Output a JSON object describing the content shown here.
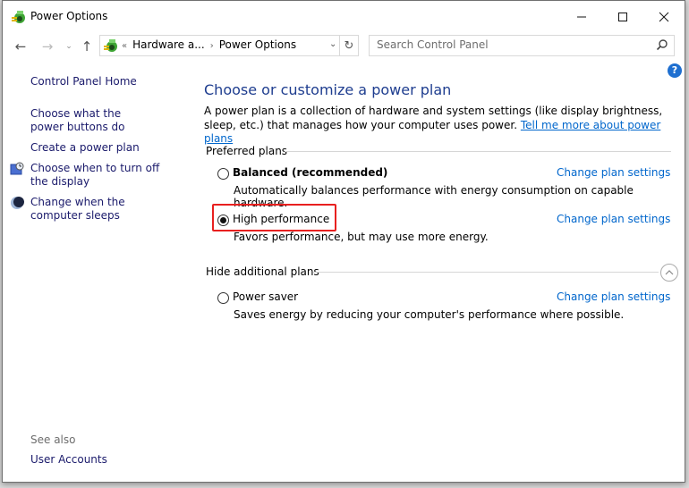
{
  "window": {
    "title": "Power Options",
    "controls": {
      "minimize": "minimize",
      "maximize": "maximize",
      "close": "close"
    }
  },
  "nav": {
    "back_icon": "arrow-left-icon",
    "forward_icon": "arrow-right-icon",
    "recent_icon": "chevron-down-icon",
    "up_icon": "arrow-up-icon",
    "breadcrumb_overflow": "«",
    "breadcrumb": [
      "Hardware a...",
      "Power Options"
    ],
    "breadcrumb_separator": "›",
    "refresh_icon": "refresh-icon"
  },
  "search": {
    "placeholder": "Search Control Panel"
  },
  "sidebar": {
    "home": "Control Panel Home",
    "links": [
      {
        "label": "Choose what the power buttons do",
        "icon": null
      },
      {
        "label": "Create a power plan",
        "icon": null
      },
      {
        "label": "Choose when to turn off the display",
        "icon": "display-clock-icon"
      },
      {
        "label": "Change when the computer sleeps",
        "icon": "moon-icon"
      }
    ],
    "see_also_label": "See also",
    "see_also_links": [
      "User Accounts"
    ]
  },
  "main": {
    "heading": "Choose or customize a power plan",
    "description": "A power plan is a collection of hardware and system settings (like display brightness, sleep, etc.) that manages how your computer uses power.",
    "learn_more_link": "Tell me more about power plans",
    "preferred_label": "Preferred plans",
    "additional_label": "Hide additional plans",
    "change_link": "Change plan settings",
    "plans": [
      {
        "name": "Balanced (recommended)",
        "desc": "Automatically balances performance with energy consumption on capable hardware.",
        "selected": false,
        "bold": true
      },
      {
        "name": "High performance",
        "desc": "Favors performance, but may use more energy.",
        "selected": true,
        "bold": false
      },
      {
        "name": "Power saver",
        "desc": "Saves energy by reducing your computer's performance where possible.",
        "selected": false,
        "bold": false
      }
    ]
  },
  "colors": {
    "link": "#0066cc",
    "heading": "#1e3d8f",
    "highlight": "#e8201f",
    "help": "#1e6fd0"
  }
}
